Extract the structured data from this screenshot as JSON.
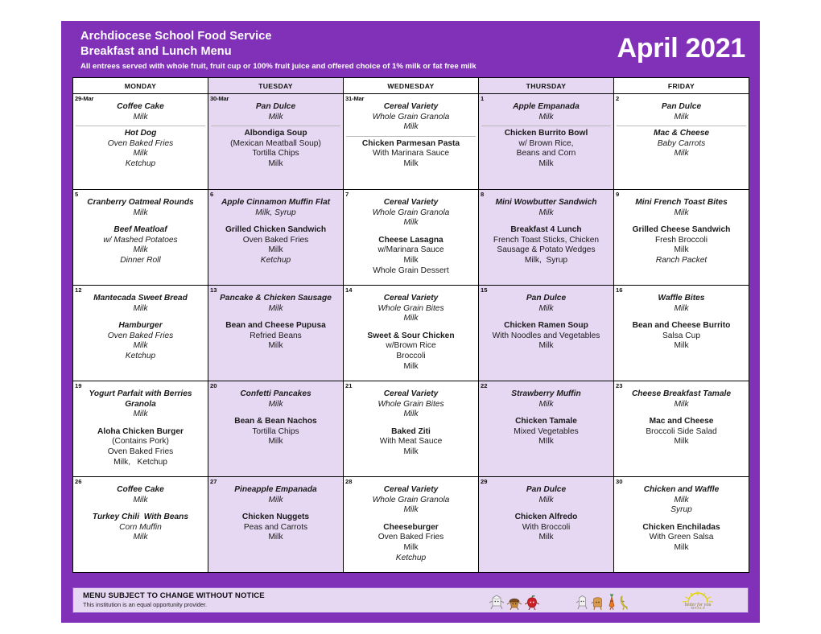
{
  "header": {
    "org_title": "Archdiocese School Food Service",
    "menu_title": "Breakfast and Lunch Menu",
    "subnote": "All entrees served with whole fruit, fruit cup or 100% fruit juice and offered choice of 1% milk or fat free milk",
    "month": "April 2021"
  },
  "colors": {
    "brand_purple": "#8031b8",
    "alt_column": "#e6d7f2",
    "border": "#000000",
    "footer_border": "#9a59cf"
  },
  "day_headers": [
    "MONDAY",
    "TUESDAY",
    "WEDNESDAY",
    "THURSDAY",
    "FRIDAY"
  ],
  "weeks": [
    {
      "days": [
        {
          "num": "29-Mar",
          "divider": true,
          "breakfast": [
            {
              "text": "Coffee Cake",
              "style": "bi"
            },
            {
              "text": "Milk",
              "style": "i"
            }
          ],
          "lunch": [
            {
              "text": "Hot Dog",
              "style": "bi"
            },
            {
              "text": "Oven Baked Fries",
              "style": "i"
            },
            {
              "text": "Milk",
              "style": "i"
            },
            {
              "text": "Ketchup",
              "style": "i"
            }
          ]
        },
        {
          "num": "30-Mar",
          "divider": true,
          "breakfast": [
            {
              "text": "Pan Dulce",
              "style": "bi"
            },
            {
              "text": "Milk",
              "style": "i"
            }
          ],
          "lunch": [
            {
              "text": "Albondiga Soup",
              "style": "b"
            },
            {
              "text": "(Mexican Meatball Soup)",
              "style": ""
            },
            {
              "text": "Tortilla Chips",
              "style": ""
            },
            {
              "text": "Milk",
              "style": ""
            }
          ]
        },
        {
          "num": "31-Mar",
          "divider": true,
          "breakfast": [
            {
              "text": "Cereal Variety",
              "style": "bi"
            },
            {
              "text": "Whole Grain Granola",
              "style": "i"
            },
            {
              "text": "Milk",
              "style": "i"
            }
          ],
          "lunch": [
            {
              "text": "Chicken Parmesan Pasta",
              "style": "b"
            },
            {
              "text": "With Marinara Sauce",
              "style": ""
            },
            {
              "text": "Milk",
              "style": ""
            }
          ]
        },
        {
          "num": "1",
          "divider": true,
          "breakfast": [
            {
              "text": "Apple Empanada",
              "style": "bi"
            },
            {
              "text": "Milk",
              "style": "i"
            }
          ],
          "lunch": [
            {
              "text": "Chicken Burrito Bowl",
              "style": "b"
            },
            {
              "text": "w/ Brown Rice,",
              "style": ""
            },
            {
              "text": "Beans and Corn",
              "style": ""
            },
            {
              "text": "Milk",
              "style": ""
            }
          ]
        },
        {
          "num": "2",
          "divider": true,
          "breakfast": [
            {
              "text": "Pan Dulce",
              "style": "bi"
            },
            {
              "text": "Milk",
              "style": "i"
            }
          ],
          "lunch": [
            {
              "text": "Mac & Cheese",
              "style": "bi"
            },
            {
              "text": "Baby Carrots",
              "style": "i"
            },
            {
              "text": "Milk",
              "style": "i"
            }
          ]
        }
      ]
    },
    {
      "days": [
        {
          "num": "5",
          "divider": false,
          "breakfast": [
            {
              "text": "Cranberry Oatmeal Rounds",
              "style": "bi"
            },
            {
              "text": "Milk",
              "style": "i"
            }
          ],
          "lunch": [
            {
              "text": "Beef Meatloaf",
              "style": "bi"
            },
            {
              "text": "w/ Mashed Potatoes",
              "style": "i"
            },
            {
              "text": "Milk",
              "style": "i"
            },
            {
              "text": "Dinner Roll",
              "style": "i"
            }
          ]
        },
        {
          "num": "6",
          "divider": false,
          "breakfast": [
            {
              "text": "Apple Cinnamon Muffin Flat",
              "style": "bi"
            },
            {
              "text": "Milk, Syrup",
              "style": "i"
            }
          ],
          "lunch": [
            {
              "text": "Grilled Chicken Sandwich",
              "style": "b"
            },
            {
              "text": "Oven Baked Fries",
              "style": ""
            },
            {
              "text": "Milk",
              "style": ""
            },
            {
              "text": "Ketchup",
              "style": "i"
            }
          ]
        },
        {
          "num": "7",
          "divider": false,
          "breakfast": [
            {
              "text": "Cereal Variety",
              "style": "bi"
            },
            {
              "text": "Whole Grain Granola",
              "style": "i"
            },
            {
              "text": "Milk",
              "style": "i"
            }
          ],
          "lunch": [
            {
              "text": "Cheese Lasagna",
              "style": "b"
            },
            {
              "text": "w/Marinara Sauce",
              "style": ""
            },
            {
              "text": "Milk",
              "style": ""
            },
            {
              "text": "Whole Grain Dessert",
              "style": ""
            }
          ]
        },
        {
          "num": "8",
          "divider": false,
          "breakfast": [
            {
              "text": "Mini Wowbutter Sandwich",
              "style": "bi"
            },
            {
              "text": "Milk",
              "style": "i"
            }
          ],
          "lunch": [
            {
              "text": "Breakfast 4 Lunch",
              "style": "b"
            },
            {
              "text": "French Toast Sticks, Chicken",
              "style": ""
            },
            {
              "text": "Sausage & Potato Wedges",
              "style": ""
            },
            {
              "text": "Milk,  Syrup",
              "style": ""
            }
          ]
        },
        {
          "num": "9",
          "divider": false,
          "breakfast": [
            {
              "text": "Mini French Toast Bites",
              "style": "bi"
            },
            {
              "text": "Milk",
              "style": "i"
            }
          ],
          "lunch": [
            {
              "text": "Grilled Cheese Sandwich",
              "style": "b"
            },
            {
              "text": "Fresh Broccoli",
              "style": ""
            },
            {
              "text": "Milk",
              "style": ""
            },
            {
              "text": "Ranch Packet",
              "style": "i"
            }
          ]
        }
      ]
    },
    {
      "days": [
        {
          "num": "12",
          "divider": false,
          "breakfast": [
            {
              "text": "Mantecada Sweet Bread",
              "style": "bi"
            },
            {
              "text": "Milk",
              "style": "i"
            }
          ],
          "lunch": [
            {
              "text": "Hamburger",
              "style": "bi"
            },
            {
              "text": "Oven Baked Fries",
              "style": "i"
            },
            {
              "text": "Milk",
              "style": "i"
            },
            {
              "text": "Ketchup",
              "style": "i"
            }
          ]
        },
        {
          "num": "13",
          "divider": false,
          "breakfast": [
            {
              "text": "Pancake & Chicken Sausage",
              "style": "bi"
            },
            {
              "text": "Milk",
              "style": "i"
            }
          ],
          "lunch": [
            {
              "text": "Bean and Cheese Pupusa",
              "style": "b"
            },
            {
              "text": "Refried Beans",
              "style": ""
            },
            {
              "text": "Milk",
              "style": ""
            }
          ]
        },
        {
          "num": "14",
          "divider": false,
          "breakfast": [
            {
              "text": "Cereal Variety",
              "style": "bi"
            },
            {
              "text": "Whole Grain Bites",
              "style": "i"
            },
            {
              "text": "Milk",
              "style": "i"
            }
          ],
          "lunch": [
            {
              "text": "Sweet & Sour Chicken",
              "style": "b"
            },
            {
              "text": "w/Brown Rice",
              "style": ""
            },
            {
              "text": "Broccoli",
              "style": ""
            },
            {
              "text": "Milk",
              "style": ""
            }
          ]
        },
        {
          "num": "15",
          "divider": false,
          "breakfast": [
            {
              "text": "Pan Dulce",
              "style": "bi"
            },
            {
              "text": "Milk",
              "style": "i"
            }
          ],
          "lunch": [
            {
              "text": "Chicken Ramen Soup",
              "style": "b"
            },
            {
              "text": "With Noodles and Vegetables",
              "style": ""
            },
            {
              "text": "Milk",
              "style": ""
            }
          ]
        },
        {
          "num": "16",
          "divider": false,
          "breakfast": [
            {
              "text": "Waffle Bites",
              "style": "bi"
            },
            {
              "text": "Milk",
              "style": "i"
            }
          ],
          "lunch": [
            {
              "text": "Bean and Cheese Burrito",
              "style": "b"
            },
            {
              "text": "Salsa Cup",
              "style": ""
            },
            {
              "text": "Milk",
              "style": ""
            }
          ]
        }
      ]
    },
    {
      "days": [
        {
          "num": "19",
          "divider": false,
          "breakfast": [
            {
              "text": "Yogurt Parfait with Berries",
              "style": "bi"
            },
            {
              "text": "Granola",
              "style": "bi"
            },
            {
              "text": "Milk",
              "style": "i"
            }
          ],
          "lunch": [
            {
              "text": "Aloha Chicken Burger",
              "style": "b"
            },
            {
              "text": "(Contains Pork)",
              "style": ""
            },
            {
              "text": "Oven Baked Fries",
              "style": ""
            },
            {
              "text": "Milk,   Ketchup",
              "style": ""
            }
          ]
        },
        {
          "num": "20",
          "divider": false,
          "breakfast": [
            {
              "text": "Confetti Pancakes",
              "style": "bi"
            },
            {
              "text": "Milk",
              "style": "i"
            }
          ],
          "lunch": [
            {
              "text": "Bean & Bean Nachos",
              "style": "b"
            },
            {
              "text": "Tortilla Chips",
              "style": ""
            },
            {
              "text": "Milk",
              "style": ""
            }
          ]
        },
        {
          "num": "21",
          "divider": false,
          "breakfast": [
            {
              "text": "Cereal Variety",
              "style": "bi"
            },
            {
              "text": "Whole Grain Bites",
              "style": "i"
            },
            {
              "text": "Milk",
              "style": "i"
            }
          ],
          "lunch": [
            {
              "text": "Baked Ziti",
              "style": "b"
            },
            {
              "text": "With Meat Sauce",
              "style": ""
            },
            {
              "text": "Milk",
              "style": ""
            }
          ]
        },
        {
          "num": "22",
          "divider": false,
          "breakfast": [
            {
              "text": "Strawberry Muffin",
              "style": "bi"
            },
            {
              "text": "Milk",
              "style": "i"
            }
          ],
          "lunch": [
            {
              "text": "Chicken Tamale",
              "style": "b"
            },
            {
              "text": "Mixed Vegetables",
              "style": ""
            },
            {
              "text": "MIlk",
              "style": ""
            }
          ]
        },
        {
          "num": "23",
          "divider": false,
          "breakfast": [
            {
              "text": "Cheese Breakfast Tamale",
              "style": "bi"
            },
            {
              "text": "Milk",
              "style": "i"
            }
          ],
          "lunch": [
            {
              "text": "Mac and Cheese",
              "style": "b"
            },
            {
              "text": "Broccoli Side Salad",
              "style": ""
            },
            {
              "text": "Milk",
              "style": ""
            }
          ]
        }
      ]
    },
    {
      "days": [
        {
          "num": "26",
          "divider": false,
          "breakfast": [
            {
              "text": "Coffee Cake",
              "style": "bi"
            },
            {
              "text": "Milk",
              "style": "i"
            }
          ],
          "lunch": [
            {
              "text": "Turkey Chili  With Beans",
              "style": "bi"
            },
            {
              "text": "Corn Muffin",
              "style": "i"
            },
            {
              "text": "Milk",
              "style": "i"
            }
          ]
        },
        {
          "num": "27",
          "divider": false,
          "breakfast": [
            {
              "text": "Pineapple Empanada",
              "style": "bi"
            },
            {
              "text": "Milk",
              "style": "i"
            }
          ],
          "lunch": [
            {
              "text": "Chicken Nuggets",
              "style": "b"
            },
            {
              "text": "Peas and Carrots",
              "style": ""
            },
            {
              "text": "Milk",
              "style": ""
            }
          ]
        },
        {
          "num": "28",
          "divider": false,
          "breakfast": [
            {
              "text": "Cereal Variety",
              "style": "bi"
            },
            {
              "text": "Whole Grain Granola",
              "style": "i"
            },
            {
              "text": "Milk",
              "style": "i"
            }
          ],
          "lunch": [
            {
              "text": "Cheeseburger",
              "style": "b"
            },
            {
              "text": "Oven Baked Fries",
              "style": ""
            },
            {
              "text": "Milk",
              "style": ""
            },
            {
              "text": "Ketchup",
              "style": "i"
            }
          ]
        },
        {
          "num": "29",
          "divider": false,
          "breakfast": [
            {
              "text": "Pan Dulce",
              "style": "bi"
            },
            {
              "text": "Milk",
              "style": "i"
            }
          ],
          "lunch": [
            {
              "text": "Chicken Alfredo",
              "style": "b"
            },
            {
              "text": "With Broccoli",
              "style": ""
            },
            {
              "text": "Milk",
              "style": ""
            }
          ]
        },
        {
          "num": "30",
          "divider": false,
          "breakfast": [
            {
              "text": "Chicken and Waffle",
              "style": "bi"
            },
            {
              "text": "Milk",
              "style": "i"
            },
            {
              "text": "Syrup",
              "style": "i"
            }
          ],
          "lunch": [
            {
              "text": "Chicken Enchiladas",
              "style": "b"
            },
            {
              "text": "With Green Salsa",
              "style": ""
            },
            {
              "text": "Milk",
              "style": ""
            }
          ]
        }
      ]
    }
  ],
  "footer": {
    "notice": "MENU SUBJECT TO CHANGE WITHOUT NOTICE",
    "provider": "This institution is an equal opportunity provider.",
    "icons": [
      "milk-carton-character-icon",
      "muffin-character-icon",
      "apple-character-icon",
      "milk-carton-character-icon",
      "bread-character-icon",
      "carrot-character-icon",
      "banana-character-icon",
      "sunrise-logo-icon"
    ]
  }
}
